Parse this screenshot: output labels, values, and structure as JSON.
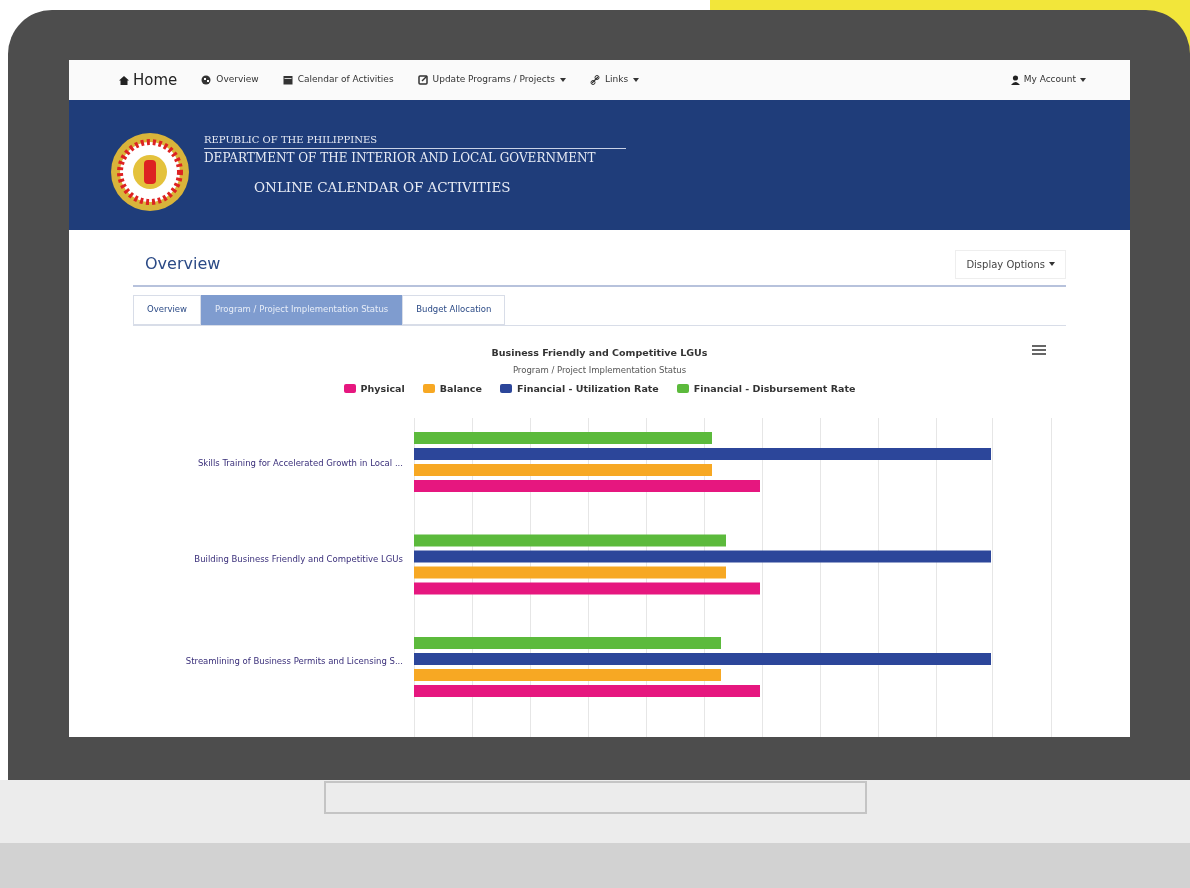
{
  "navbar": {
    "brand": "Home",
    "items": [
      {
        "label": "Overview",
        "dropdown": false
      },
      {
        "label": "Calendar of Activities",
        "dropdown": false
      },
      {
        "label": "Update Programs / Projects",
        "dropdown": true
      },
      {
        "label": "Links",
        "dropdown": true
      }
    ],
    "account": "My Account"
  },
  "banner": {
    "line_1": "REPUBLIC OF THE PHILIPPINES",
    "line_2": "DEPARTMENT OF THE INTERIOR AND LOCAL GOVERNMENT",
    "line_3": "ONLINE CALENDAR OF ACTIVITIES"
  },
  "page": {
    "title": "Overview",
    "display_options": "Display Options"
  },
  "tabs": [
    {
      "label": "Overview",
      "selected": false
    },
    {
      "label": "Program / Project Implementation Status",
      "selected": true
    },
    {
      "label": "Budget Allocation",
      "selected": false
    }
  ],
  "chart": {
    "title": "Business Friendly and Competitive LGUs",
    "subtitle": "Program / Project Implementation Status",
    "legend": [
      {
        "name": "Physical",
        "color": "#e6177f"
      },
      {
        "name": "Balance",
        "color": "#f7a823"
      },
      {
        "name": "Financial - Utilization Rate",
        "color": "#2c469a"
      },
      {
        "name": "Financial - Disbursement Rate",
        "color": "#5cba3c"
      }
    ],
    "categories": [
      "Skills Training for Accelerated Growth in Local ...",
      "Building Business Friendly and Competitive LGUs",
      "Streamlining of Business Permits and Licensing S..."
    ]
  }
}
